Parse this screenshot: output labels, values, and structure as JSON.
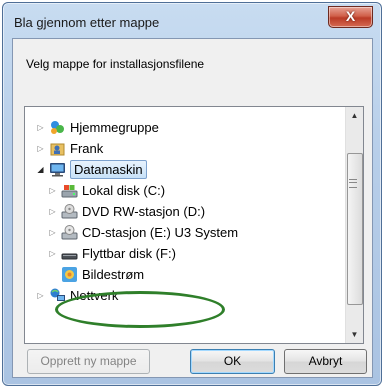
{
  "window": {
    "title": "Bla gjennom etter mappe",
    "close_label": "X"
  },
  "instruction": "Velg mappe for installasjonsfilene",
  "tree": {
    "items": [
      {
        "label": "Hjemmegruppe",
        "icon": "homegroup-icon",
        "expander": "collapsed"
      },
      {
        "label": "Frank",
        "icon": "user-folder-icon",
        "expander": "collapsed"
      },
      {
        "label": "Datamaskin",
        "icon": "computer-icon",
        "expander": "expanded",
        "selected": true
      },
      {
        "label": "Lokal disk (C:)",
        "icon": "hard-disk-icon",
        "expander": "collapsed"
      },
      {
        "label": "DVD RW-stasjon (D:)",
        "icon": "dvd-drive-icon",
        "expander": "collapsed"
      },
      {
        "label": "CD-stasjon (E:) U3 System",
        "icon": "cd-drive-icon",
        "expander": "collapsed"
      },
      {
        "label": "Flyttbar disk (F:)",
        "icon": "removable-disk-icon",
        "expander": "collapsed"
      },
      {
        "label": "Bildestrøm",
        "icon": "picture-stream-icon",
        "expander": "none"
      },
      {
        "label": "Nettverk",
        "icon": "network-icon",
        "expander": "collapsed"
      }
    ]
  },
  "buttons": {
    "new_folder": "Opprett ny mappe",
    "ok": "OK",
    "cancel": "Avbryt"
  },
  "colors": {
    "highlight_ring": "#2f7f2a",
    "selection": "#cce4f7"
  }
}
